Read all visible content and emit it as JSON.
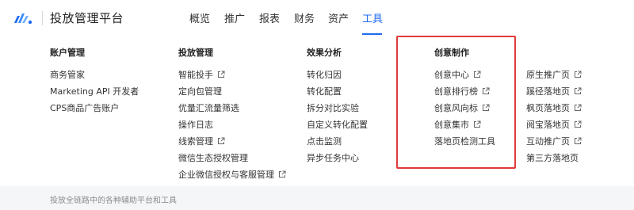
{
  "header": {
    "title": "投放管理平台",
    "logo_icon": "logo-icon",
    "nav": [
      {
        "label": "概览",
        "active": false
      },
      {
        "label": "推广",
        "active": false
      },
      {
        "label": "报表",
        "active": false
      },
      {
        "label": "财务",
        "active": false
      },
      {
        "label": "资产",
        "active": false
      },
      {
        "label": "工具",
        "active": true
      }
    ]
  },
  "menu": {
    "columns": [
      {
        "title": "账户管理",
        "items": [
          {
            "label": "商务管家",
            "external": false
          },
          {
            "label": "Marketing API 开发者",
            "external": false
          },
          {
            "label": "CPS商品广告账户",
            "external": false
          }
        ]
      },
      {
        "title": "投放管理",
        "items": [
          {
            "label": "智能投手",
            "external": true
          },
          {
            "label": "定向包管理",
            "external": false
          },
          {
            "label": "优量汇流量筛选",
            "external": false
          },
          {
            "label": "操作日志",
            "external": false
          },
          {
            "label": "线索管理",
            "external": true
          },
          {
            "label": "微信生态授权管理",
            "external": false
          },
          {
            "label": "企业微信授权与客服管理",
            "external": true
          }
        ]
      },
      {
        "title": "效果分析",
        "items": [
          {
            "label": "转化归因",
            "external": false
          },
          {
            "label": "转化配置",
            "external": false
          },
          {
            "label": "拆分对比实验",
            "external": false
          },
          {
            "label": "自定义转化配置",
            "external": false
          },
          {
            "label": "点击监测",
            "external": false
          },
          {
            "label": "异步任务中心",
            "external": false
          }
        ]
      },
      {
        "title": "创意制作",
        "items": [
          {
            "label": "创意中心",
            "external": true
          },
          {
            "label": "创意排行榜",
            "external": true
          },
          {
            "label": "创意风向标",
            "external": true
          },
          {
            "label": "创意集市",
            "external": true
          },
          {
            "label": "落地页检测工具",
            "external": false
          }
        ]
      },
      {
        "title": "",
        "items": [
          {
            "label": "原生推广页",
            "external": true
          },
          {
            "label": "蹊径落地页",
            "external": true
          },
          {
            "label": "枫页落地页",
            "external": true
          },
          {
            "label": "阅宝落地页",
            "external": true
          },
          {
            "label": "互动推广页",
            "external": true
          },
          {
            "label": "第三方落地页",
            "external": false
          }
        ]
      }
    ]
  },
  "footer": {
    "text": "投放全链路中的各种辅助平台和工具"
  },
  "colors": {
    "accent": "#1e6bf0",
    "highlight": "#e03a3a",
    "footer_bg": "#f5f6f7"
  }
}
